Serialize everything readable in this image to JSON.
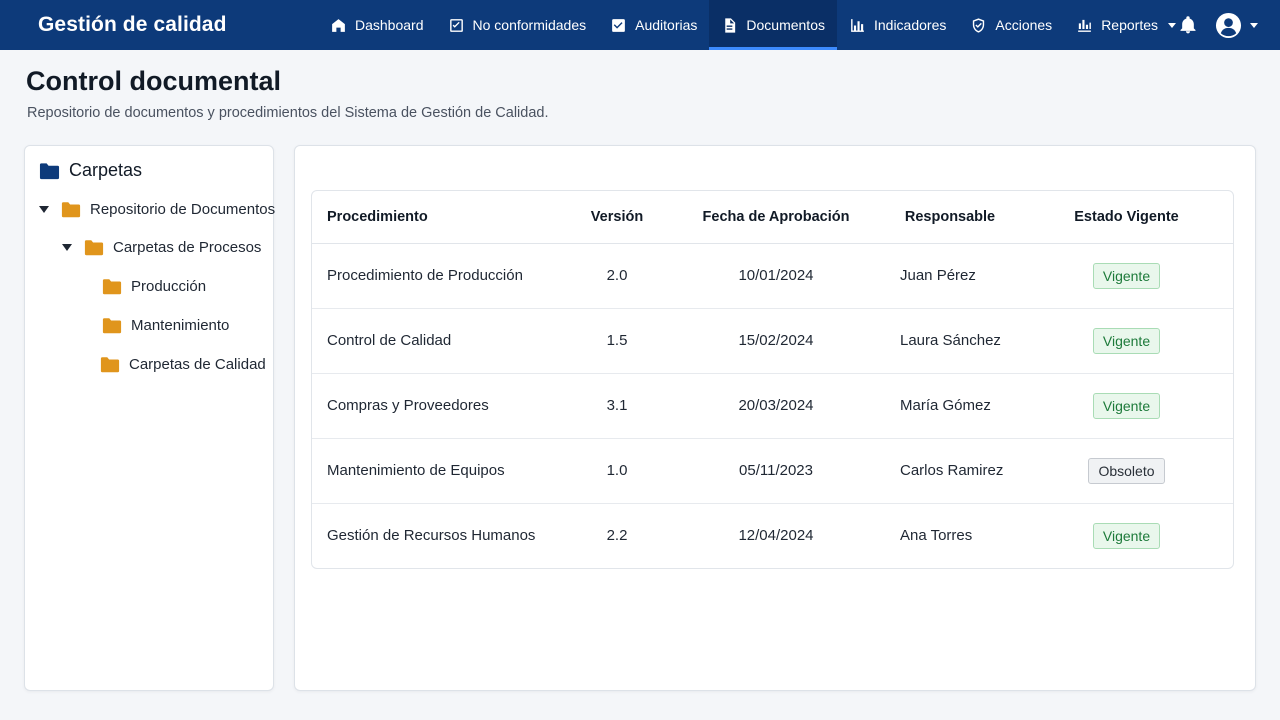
{
  "app": {
    "brand": "Gestión de calidad"
  },
  "nav": {
    "items": [
      {
        "label": "Dashboard",
        "icon": "home-icon"
      },
      {
        "label": "No conformidades",
        "icon": "checkbox-icon"
      },
      {
        "label": "Auditorias",
        "icon": "clipboard-check-icon"
      },
      {
        "label": "Documentos",
        "icon": "document-icon",
        "active": true
      },
      {
        "label": "Indicadores",
        "icon": "bar-chart-icon"
      },
      {
        "label": "Acciones",
        "icon": "shield-check-icon"
      },
      {
        "label": "Reportes",
        "icon": "report-chart-icon"
      }
    ]
  },
  "page": {
    "title": "Control documental",
    "subtitle": "Repositorio de documentos y procedimientos del Sistema de Gestión de Calidad."
  },
  "sidebar": {
    "heading": "Carpetas",
    "tree": [
      {
        "label": "Repositorio de Documentos",
        "expanded": true
      },
      {
        "label": "Carpetas de Procesos",
        "expanded": true
      },
      {
        "label": "Producción"
      },
      {
        "label": "Mantenimiento"
      },
      {
        "label": "Carpetas de Calidad"
      }
    ]
  },
  "table": {
    "headers": [
      "Procedimiento",
      "Versión",
      "Fecha de Aprobación",
      "Responsable",
      "Estado Vigente"
    ],
    "rows": [
      {
        "name": "Procedimiento de Producción",
        "version": "2.0",
        "date": "10/01/2024",
        "owner": "Juan Pérez",
        "status": "Vigente"
      },
      {
        "name": "Control de Calidad",
        "version": "1.5",
        "date": "15/02/2024",
        "owner": "Laura Sánchez",
        "status": "Vigente"
      },
      {
        "name": "Compras y Proveedores",
        "version": "3.1",
        "date": "20/03/2024",
        "owner": "María Gómez",
        "status": "Vigente"
      },
      {
        "name": "Mantenimiento de Equipos",
        "version": "1.0",
        "date": "05/11/2023",
        "owner": "Carlos Ramirez",
        "status": "Obsoleto"
      },
      {
        "name": "Gestión de Recursos Humanos",
        "version": "2.2",
        "date": "12/04/2024",
        "owner": "Ana Torres",
        "status": "Vigente"
      }
    ]
  },
  "colors": {
    "navbar": "#0d3a7a",
    "folder": "#e0951c",
    "folder_dark": "#0d3a7a",
    "active_badge": "#1d7a3a"
  }
}
